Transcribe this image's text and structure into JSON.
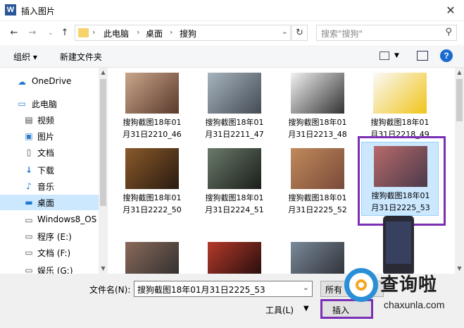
{
  "window": {
    "title": "插入图片",
    "app_icon": "W"
  },
  "nav": {
    "breadcrumb": [
      "此电脑",
      "桌面",
      "搜狗"
    ],
    "search_placeholder": "搜索\"搜狗\""
  },
  "toolbar": {
    "organize": "组织 ▾",
    "new_folder": "新建文件夹"
  },
  "sidebar": {
    "items": [
      {
        "label": "OneDrive",
        "icon": "cloud-icon"
      },
      {
        "label": "此电脑",
        "icon": "computer-icon"
      },
      {
        "label": "视频",
        "icon": "video-icon"
      },
      {
        "label": "图片",
        "icon": "picture-icon"
      },
      {
        "label": "文档",
        "icon": "document-icon"
      },
      {
        "label": "下载",
        "icon": "download-icon"
      },
      {
        "label": "音乐",
        "icon": "music-icon"
      },
      {
        "label": "桌面",
        "icon": "desktop-icon",
        "selected": true
      },
      {
        "label": "Windows8_OS",
        "icon": "drive-icon"
      },
      {
        "label": "程序 (E:)",
        "icon": "drive-icon"
      },
      {
        "label": "文档 (F:)",
        "icon": "drive-icon"
      },
      {
        "label": "娱乐 (G:)",
        "icon": "drive-icon"
      }
    ]
  },
  "files": [
    {
      "line1": "搜狗截图18年01",
      "line2": "月31日2210_46",
      "colors": [
        "#c9a58a",
        "#5a3a2c"
      ]
    },
    {
      "line1": "搜狗截图18年01",
      "line2": "月31日2211_47",
      "colors": [
        "#a7b4bd",
        "#444b55"
      ]
    },
    {
      "line1": "搜狗截图18年01",
      "line2": "月31日2213_48",
      "colors": [
        "#f2f2f2",
        "#333333"
      ]
    },
    {
      "line1": "搜狗截图18年01",
      "line2": "月31日2218_49",
      "colors": [
        "#fafafa",
        "#f0c419"
      ]
    },
    {
      "line1": "搜狗截图18年01",
      "line2": "月31日2222_50",
      "colors": [
        "#8a5a2a",
        "#2a1a10"
      ]
    },
    {
      "line1": "搜狗截图18年01",
      "line2": "月31日2224_51",
      "colors": [
        "#6a7a6a",
        "#1a1e1a"
      ]
    },
    {
      "line1": "搜狗截图18年01",
      "line2": "月31日2225_52",
      "colors": [
        "#c08a5a",
        "#7a4a3a"
      ]
    },
    {
      "line1": "搜狗截图18年01",
      "line2": "月31日2225_53",
      "colors": [
        "#b86a6a",
        "#4a3a4a"
      ],
      "selected": true
    },
    {
      "line1": "",
      "line2": "",
      "colors": [
        "#8a6a5a",
        "#2a2a2a"
      ]
    },
    {
      "line1": "",
      "line2": "",
      "colors": [
        "#b53a2a",
        "#1a0a0a"
      ]
    },
    {
      "line1": "",
      "line2": "",
      "colors": [
        "#7a8a9a",
        "#2a2a30"
      ]
    }
  ],
  "bottom": {
    "filename_label": "文件名(N):",
    "filename_value": "搜狗截图18年01月31日2225_53",
    "filter_label": "所有",
    "tools_label": "工具(L)",
    "insert_label": "插入"
  },
  "watermark": {
    "text": "查询啦",
    "sub": "chaxunla.com"
  },
  "colors": {
    "highlight": "#7b2fb5",
    "selection": "#cce8ff",
    "accent": "#1a6bd1"
  }
}
